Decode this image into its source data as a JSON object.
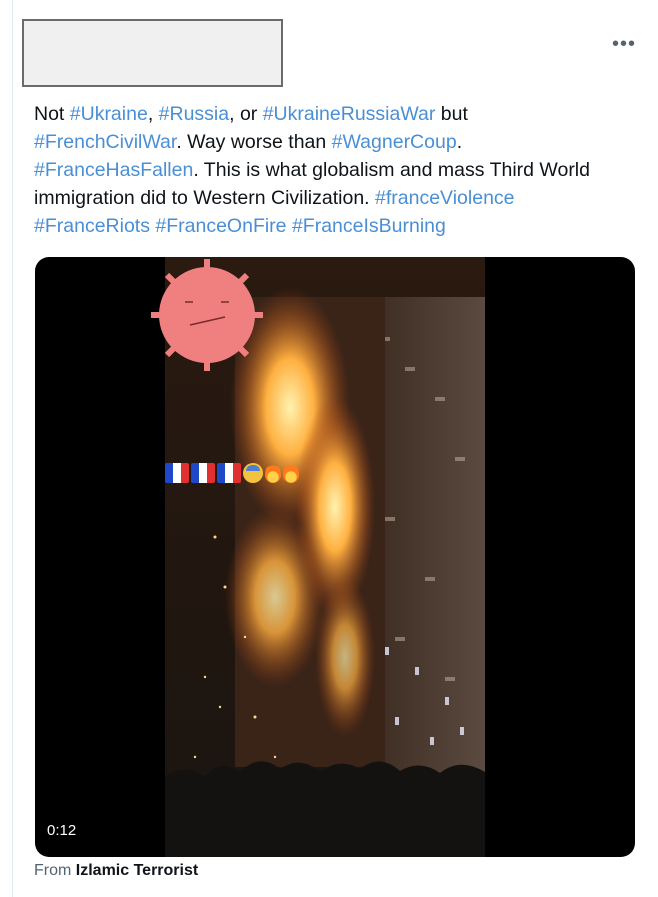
{
  "tweet": {
    "more_icon": "more-horizontal-icon",
    "lines": [
      [
        {
          "t": "Not ",
          "tag": false
        },
        {
          "t": "#Ukraine",
          "tag": true
        },
        {
          "t": ", ",
          "tag": false
        },
        {
          "t": "#Russia",
          "tag": true
        },
        {
          "t": ", or ",
          "tag": false
        },
        {
          "t": "#UkraineRussiaWar",
          "tag": true
        },
        {
          "t": " but",
          "tag": false
        }
      ],
      [
        {
          "t": "#FrenchCivilWar",
          "tag": true
        },
        {
          "t": ". Way worse than ",
          "tag": false
        },
        {
          "t": "#WagnerCoup",
          "tag": true
        },
        {
          "t": ".",
          "tag": false
        }
      ],
      [
        {
          "t": "#FranceHasFallen",
          "tag": true
        },
        {
          "t": ". This is what globalism and mass Third World",
          "tag": false
        }
      ],
      [
        {
          "t": "immigration did to Western Civilization. ",
          "tag": false
        },
        {
          "t": "#franceViolence",
          "tag": true
        }
      ],
      [
        {
          "t": "#FranceRiots",
          "tag": true
        },
        {
          "t": " ",
          "tag": false
        },
        {
          "t": "#FranceOnFire",
          "tag": true
        },
        {
          "t": " ",
          "tag": false
        },
        {
          "t": "#FranceIsBurning",
          "tag": true
        }
      ]
    ],
    "colors": {
      "hashtag": "#4a8fd6",
      "text": "#0f1419",
      "muted": "#536471"
    }
  },
  "media": {
    "duration": "0:12",
    "overlay_emojis": [
      "france-flag",
      "france-flag",
      "france-flag",
      "anxious-face",
      "fire",
      "fire"
    ]
  },
  "footer": {
    "prefix": "From",
    "source_name": "Izlamic Terrorist"
  }
}
